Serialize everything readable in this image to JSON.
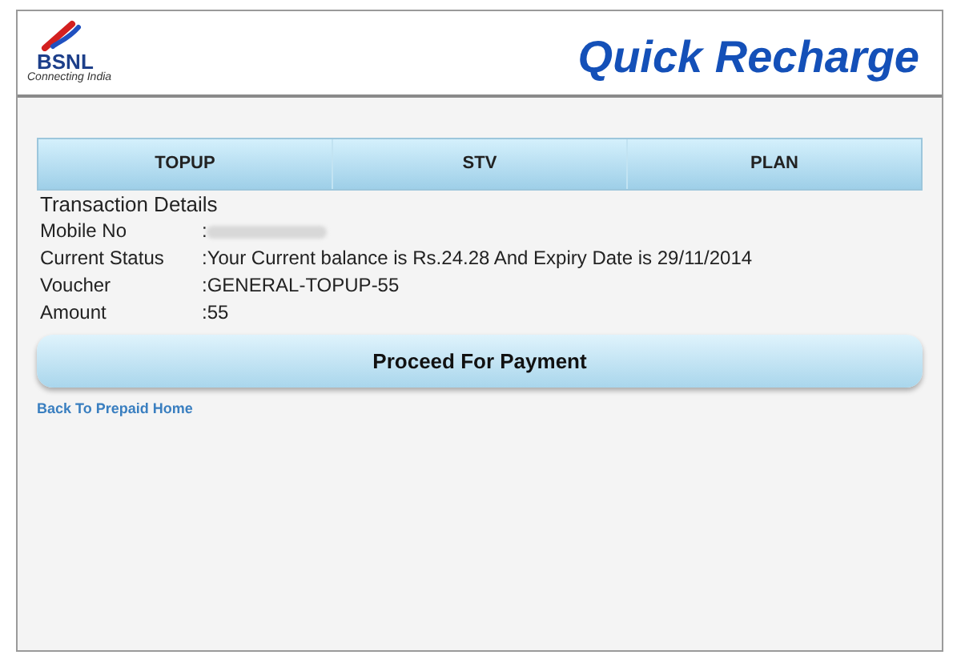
{
  "logo": {
    "name": "BSNL",
    "tagline": "Connecting India"
  },
  "title": "Quick Recharge",
  "tabs": [
    {
      "label": "TOPUP"
    },
    {
      "label": "STV"
    },
    {
      "label": "PLAN"
    }
  ],
  "section_title": "Transaction Details",
  "details": [
    {
      "kind": "redacted",
      "label": "Mobile No",
      "separator": ":"
    },
    {
      "kind": "text",
      "label": "Current Status",
      "separator": ":",
      "value": "Your Current balance is Rs.24.28 And Expiry Date is 29/11/2014"
    },
    {
      "kind": "text",
      "label": "Voucher",
      "separator": ":",
      "value": "GENERAL-TOPUP-55"
    },
    {
      "kind": "text",
      "label": "Amount",
      "separator": ":",
      "value": "55"
    }
  ],
  "proceed_button": "Proceed For Payment",
  "back_link": "Back To Prepaid Home"
}
